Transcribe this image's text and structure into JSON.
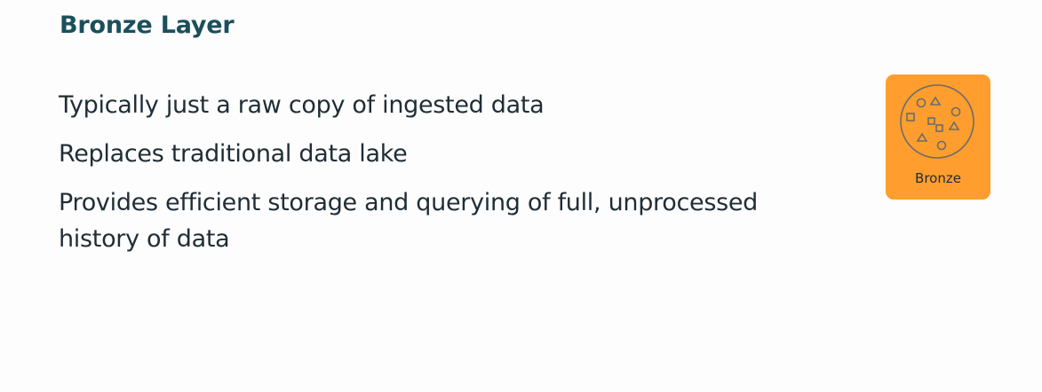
{
  "slide": {
    "title": "Bronze Layer",
    "bullets": [
      "Typically just a raw copy of ingested data",
      "Replaces traditional data lake",
      "Provides efficient storage and querying of full, unprocessed history of data"
    ]
  },
  "badge": {
    "label": "Bronze",
    "icon": "mixed-shapes-icon",
    "color": "#ff9e2e"
  }
}
